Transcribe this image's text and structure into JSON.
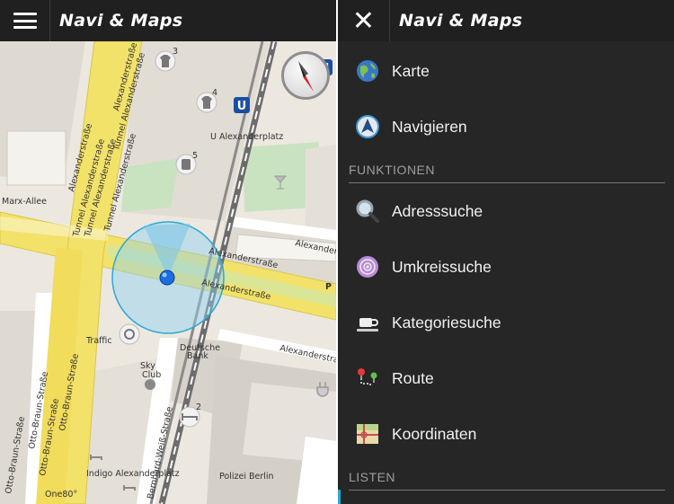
{
  "left": {
    "app_title": "Navi & Maps",
    "map": {
      "labels": [
        "Alexanderstraße",
        "Tunnel Alexanderstraße",
        "Tunnel Alexanderstraße",
        "Alexanderstraße",
        "Tunnel Alexanderstraße",
        "Tunnel Alexanderstraße",
        "Marx-Allee",
        "U Alexanderplatz",
        "Alexander...",
        "Alexanderstraße",
        "Alexanderstraße",
        "Alexanderstra...",
        "Traffic",
        "Deutsche",
        "Bank",
        "Sky",
        "Club",
        "Otto-Braun-Straße",
        "Otto-Braun-Straße",
        "Otto-Braun-Straße",
        "Otto-Braun-Straße",
        "Bernhard-Weiß-Straße",
        "Indigo Alexanderplatz",
        "Polizei Berlin",
        "One80°",
        "P",
        "3",
        "4",
        "5",
        "2"
      ]
    }
  },
  "right": {
    "app_title": "Navi & Maps",
    "close_glyph": "✕",
    "items": [
      {
        "label": "Karte",
        "icon": "globe-icon"
      },
      {
        "label": "Navigieren",
        "icon": "navigation-arrow-icon"
      }
    ],
    "section_funktionen": "FUNKTIONEN",
    "funktionen": [
      {
        "label": "Adresssuche",
        "icon": "magnifier-icon"
      },
      {
        "label": "Umkreissuche",
        "icon": "radius-search-icon"
      },
      {
        "label": "Kategoriesuche",
        "icon": "coffee-cup-icon"
      },
      {
        "label": "Route",
        "icon": "route-pins-icon"
      },
      {
        "label": "Koordinaten",
        "icon": "map-coordinates-icon"
      }
    ],
    "section_listen": "LISTEN"
  },
  "colors": {
    "appbar": "#202020",
    "map_background": "#ece8e0",
    "road_major": "#f3e26a",
    "location_accent": "#2aa8d8",
    "drawer_background": "#262626"
  }
}
